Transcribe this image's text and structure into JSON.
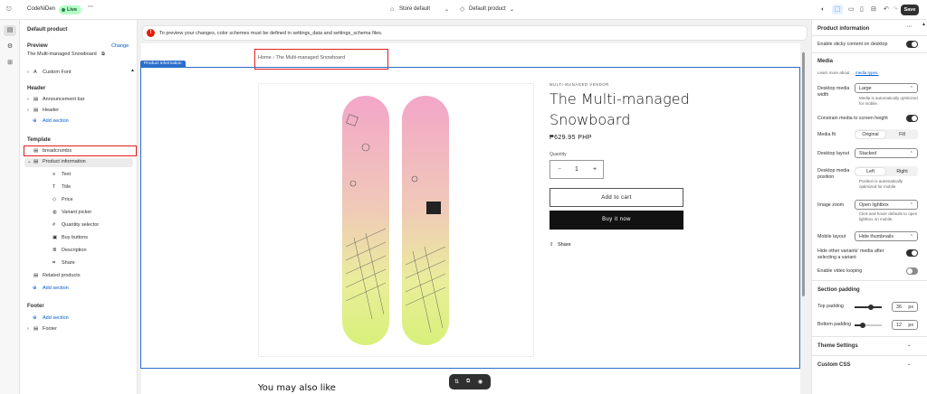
{
  "topbar": {
    "store_name": "CodeNiDen",
    "status": "Live",
    "more": "···",
    "theme_selector": "Store default",
    "template_selector": "Default product",
    "save_label": "Save"
  },
  "left_panel": {
    "title": "Default product",
    "preview_label": "Preview",
    "change_label": "Change",
    "preview_product": "The Multi-managed Snowboard",
    "custom_font": "Custom Font",
    "header_group": "Header",
    "header_items": [
      "Announcement bar",
      "Header"
    ],
    "add_section": "Add section",
    "template_group": "Template",
    "breadcrumbs": "breadcrumbs",
    "product_information": "Product information",
    "blocks": [
      "Text",
      "Title",
      "Price",
      "Variant picker",
      "Quantity selector",
      "Buy buttons",
      "Description",
      "Share"
    ],
    "related_products": "Related products",
    "add_section_2": "Add section",
    "footer_group": "Footer",
    "add_section_3": "Add section",
    "footer_item": "Footer"
  },
  "banner": {
    "text": "To preview your changes, color schemes must be defined in settings_data and settings_schema files."
  },
  "preview": {
    "breadcrumb": "Home › The Multi-managed Snowboard",
    "section_tag": "Product information",
    "vendor": "MULTI-MANAGED VENDOR",
    "title": "The Multi-managed Snowboard",
    "price": "₱629.95 PHP",
    "quantity_label": "Quantity",
    "quantity_value": "1",
    "minus": "−",
    "plus": "+",
    "add_to_cart": "Add to cart",
    "buy_now": "Buy it now",
    "share": "Share",
    "you_may_also_like": "You may also like"
  },
  "right_panel": {
    "title": "Product information",
    "more": "···",
    "sticky_label": "Enable sticky content on desktop",
    "media_heading": "Media",
    "media_learn": "Learn more about",
    "media_link": "media types.",
    "desktop_media_width_label": "Desktop media width",
    "desktop_media_width_value": "Large",
    "desktop_media_width_hint": "Media is automatically optimized for mobile.",
    "constrain_label": "Constrain media to screen height",
    "media_fit_label": "Media fit",
    "media_fit_options": [
      "Original",
      "Fill"
    ],
    "desktop_layout_label": "Desktop layout",
    "desktop_layout_value": "Stacked",
    "desktop_media_position_label": "Desktop media position",
    "desktop_media_position_options": [
      "Left",
      "Right"
    ],
    "desktop_media_position_hint": "Position is automatically optimized for mobile.",
    "image_zoom_label": "Image zoom",
    "image_zoom_value": "Open lightbox",
    "image_zoom_hint": "Click and hover defaults to open lightbox on mobile.",
    "mobile_layout_label": "Mobile layout",
    "mobile_layout_value": "Hide thumbnails",
    "hide_other_variants_label": "Hide other variants' media after selecting a variant",
    "video_looping_label": "Enable video looping",
    "section_padding_heading": "Section padding",
    "top_padding_label": "Top padding",
    "top_padding_value": "36",
    "bottom_padding_label": "Bottom padding",
    "bottom_padding_value": "12",
    "unit": "px",
    "theme_settings": "Theme Settings",
    "custom_css": "Custom CSS"
  },
  "colors": {
    "accent": "#2c6ecb",
    "highlight": "#e01e1e",
    "primary_button": "#121212"
  }
}
